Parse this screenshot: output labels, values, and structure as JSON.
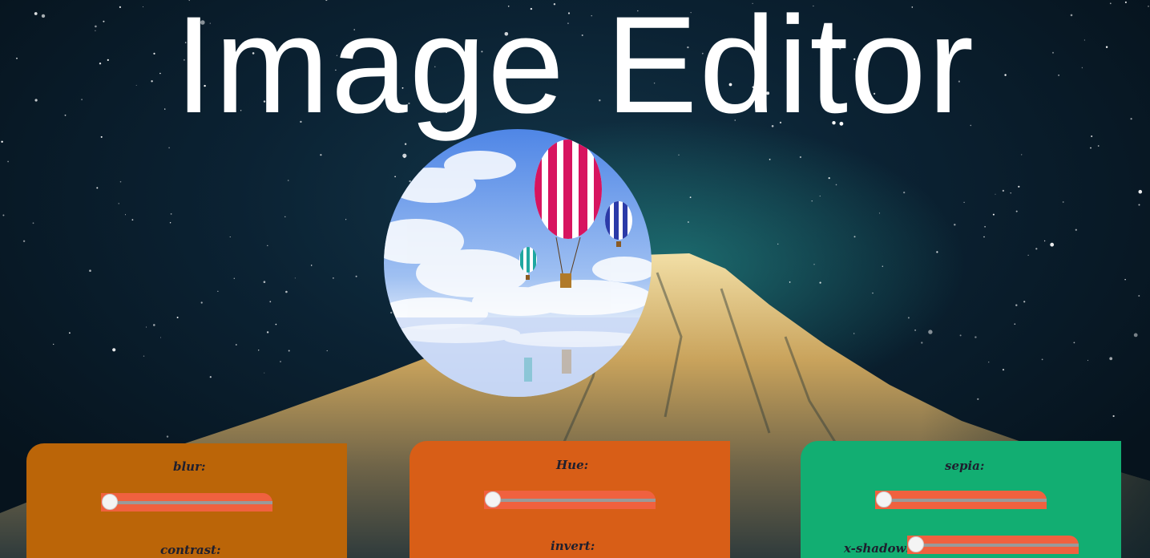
{
  "app": {
    "title": "Image Editor"
  },
  "preview": {
    "icon": "hot-air-balloon-photo"
  },
  "controls": {
    "blur": {
      "label": "blur:",
      "value": 0
    },
    "contrast": {
      "label": "contrast:"
    },
    "hue": {
      "label": "Hue:",
      "value": 0
    },
    "invert": {
      "label": "invert:"
    },
    "sepia": {
      "label": "sepia:",
      "value": 0
    },
    "x_shadow": {
      "label": "x-shadow:",
      "value": 0
    }
  },
  "colors": {
    "panel_blur": "#bb6508",
    "panel_hue": "#d85e17",
    "panel_sepia": "#12ae72",
    "slider_fill": "#f0613f",
    "title": "#ffffff"
  }
}
